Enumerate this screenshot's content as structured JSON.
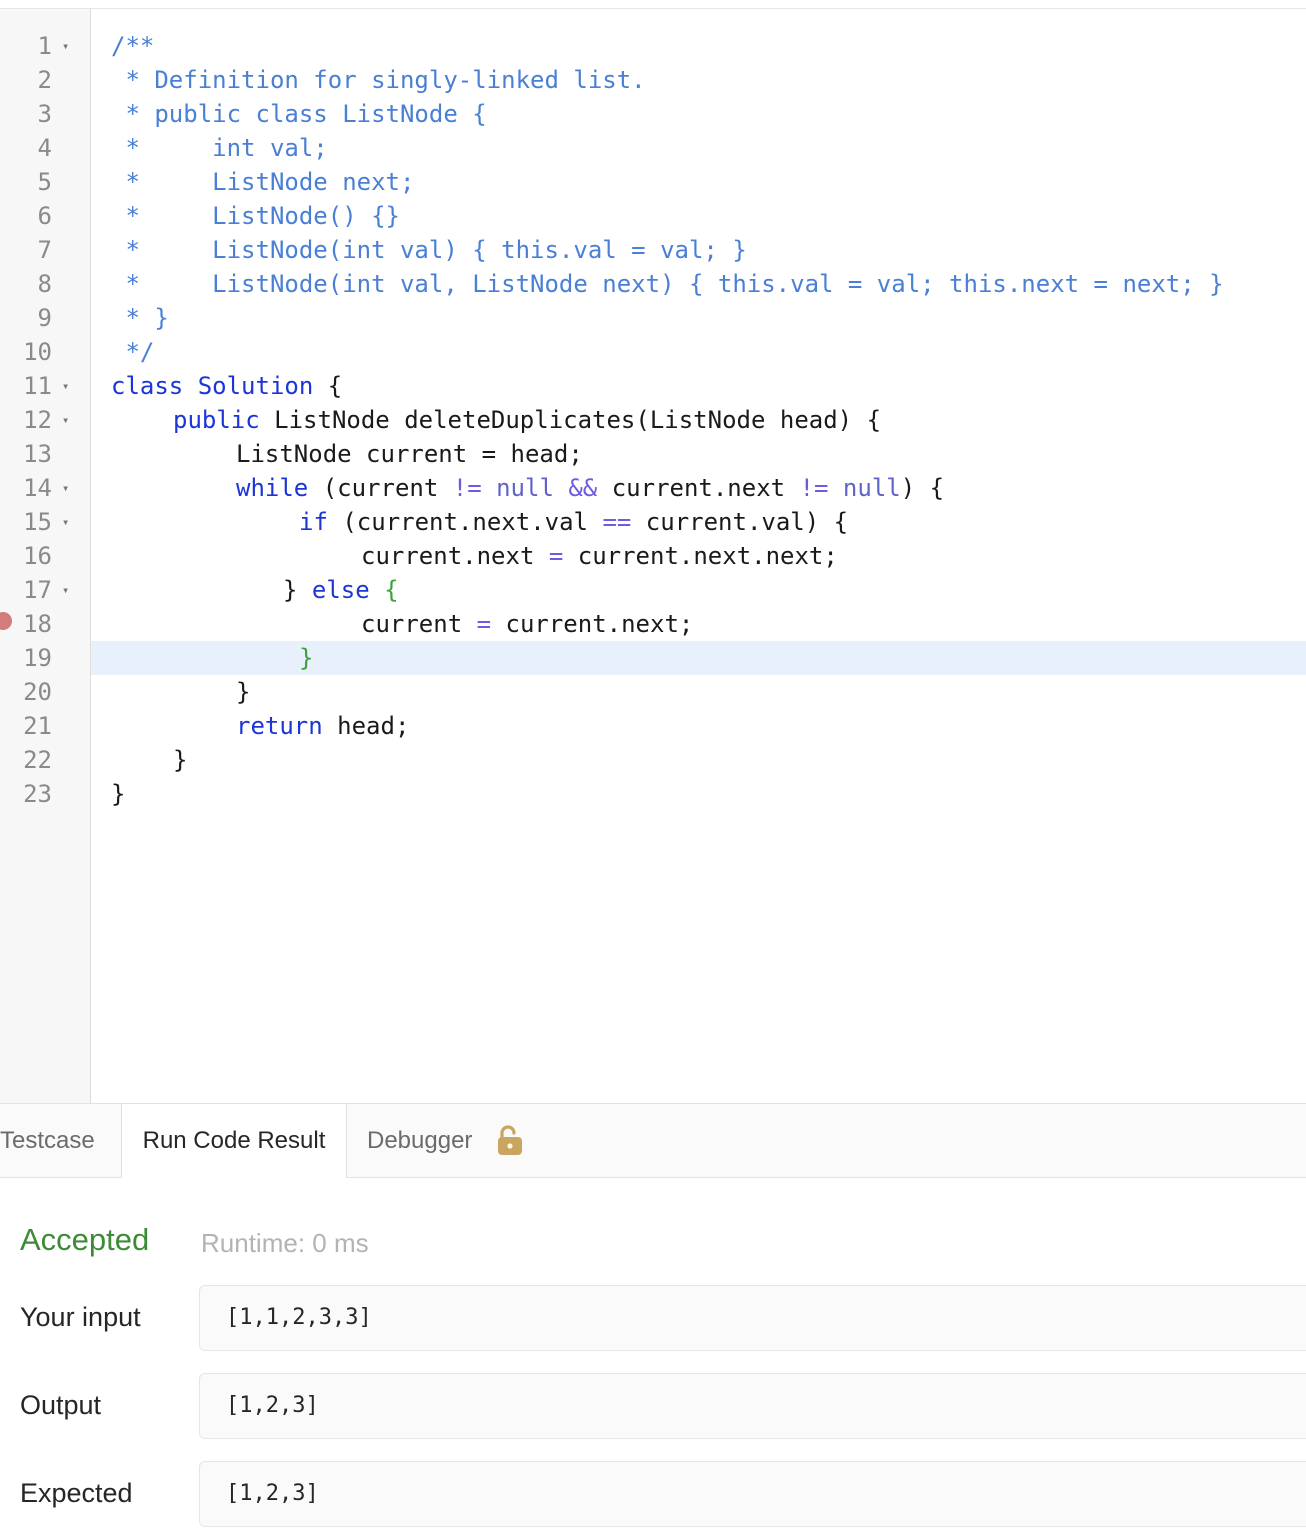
{
  "editor": {
    "line_numbers": [
      "1",
      "2",
      "3",
      "4",
      "5",
      "6",
      "7",
      "8",
      "9",
      "10",
      "11",
      "12",
      "13",
      "14",
      "15",
      "16",
      "17",
      "18",
      "19",
      "20",
      "21",
      "22",
      "23"
    ],
    "fold_marker": "▾",
    "code": {
      "l1": "/**",
      "l2": " * Definition for singly-linked list.",
      "l3": " * public class ListNode {",
      "l4": " *     int val;",
      "l5": " *     ListNode next;",
      "l6": " *     ListNode() {}",
      "l7": " *     ListNode(int val) { this.val = val; }",
      "l8": " *     ListNode(int val, ListNode next) { this.val = val; this.next = next; }",
      "l9": " * }",
      "l10": " */",
      "kw_class": "class",
      "solution_name": " Solution",
      "brace_open": " {",
      "kw_public": "public",
      "method_sig": " ListNode deleteDuplicates(ListNode head) {",
      "l13": "ListNode current = head;",
      "kw_while": "while",
      "while_open": " (current ",
      "neq": "!=",
      "kw_null": "null",
      "and": "&&",
      "current_next": " current.next ",
      "close_brace_paren": ") {",
      "kw_if": "if",
      "if_cond": " (current.next.val ",
      "eqeq": "==",
      "if_rhs": " current.val) {",
      "assign_lhs": "current.next ",
      "eq": "=",
      "assign_rhs": " current.next.next;",
      "close_brace": "}",
      "kw_else": "else",
      "l18_lhs": "current ",
      "l18_rhs": " current.next;",
      "kw_return": "return",
      "return_rest": " head;"
    }
  },
  "tabs": {
    "testcase": "Testcase",
    "run_code_result": "Run Code Result",
    "debugger": "Debugger"
  },
  "result": {
    "status": "Accepted",
    "runtime": "Runtime: 0 ms",
    "your_input_label": "Your input",
    "your_input_value": "[1,1,2,3,3]",
    "output_label": "Output",
    "output_value": "[1,2,3]",
    "expected_label": "Expected",
    "expected_value": "[1,2,3]"
  },
  "colors": {
    "accepted": "#3d8b37",
    "keyword": "#1c35d6",
    "comment": "#4a7fd6",
    "breakpoint": "#d47b7b",
    "lock": "#c9a560"
  },
  "icons": {
    "debugger_lock": "unlocked-padlock-icon",
    "breakpoint": "breakpoint-dot-icon"
  }
}
